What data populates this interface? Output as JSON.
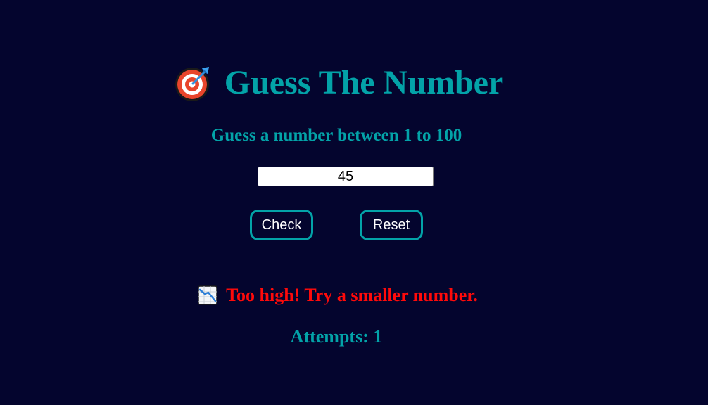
{
  "app": {
    "title": "Guess The Number",
    "subtitle": "Guess a number between 1 to 100"
  },
  "icons": {
    "title_icon": "target-icon",
    "message_icon": "chart-decreasing-icon"
  },
  "input": {
    "value": "45"
  },
  "buttons": {
    "check_label": "Check",
    "reset_label": "Reset"
  },
  "feedback": {
    "message": "Too high! Try a smaller number."
  },
  "attempts": {
    "text": "Attempts: 1"
  },
  "colors": {
    "background": "#04052e",
    "accent": "#03a3a8",
    "error": "#ff0a0a",
    "button_text": "#ffffff"
  }
}
